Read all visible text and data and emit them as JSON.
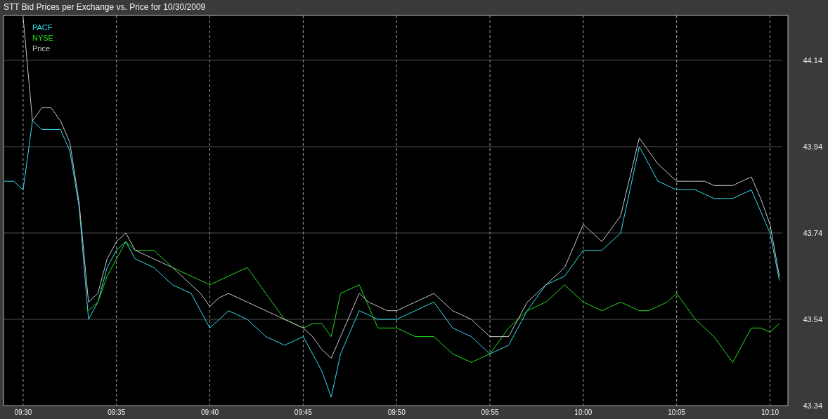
{
  "chart": {
    "chart_data": {
      "type": "line",
      "title": "STT Bid Prices per Exchange vs. Price for 10/30/2009",
      "grid": true,
      "ylim": [
        43.34,
        44.244
      ],
      "yticks": [
        {
          "value": 43.34,
          "label": "43.34"
        },
        {
          "value": 43.54,
          "label": "43.54"
        },
        {
          "value": 43.74,
          "label": "43.74"
        },
        {
          "value": 43.94,
          "label": "43.94"
        },
        {
          "value": 44.14,
          "label": "44.14"
        }
      ],
      "categories": [
        null,
        null,
        "09:30",
        null,
        null,
        null,
        null,
        null,
        null,
        null,
        null,
        null,
        "09:35",
        null,
        null,
        null,
        null,
        null,
        null,
        null,
        null,
        null,
        "09:40",
        null,
        null,
        null,
        null,
        null,
        null,
        null,
        null,
        null,
        "09:45",
        null,
        null,
        null,
        null,
        null,
        null,
        null,
        null,
        null,
        "09:50",
        null,
        null,
        null,
        null,
        null,
        null,
        null,
        null,
        null,
        "09:55",
        null,
        null,
        null,
        null,
        null,
        null,
        null,
        null,
        null,
        "10:00",
        null,
        null,
        null,
        null,
        null,
        null,
        null,
        null,
        null,
        "10:05",
        null,
        null,
        null,
        null,
        null,
        null,
        null,
        null,
        null,
        "10:10",
        null
      ],
      "series": [
        {
          "name": "PACF",
          "color": "#33e0f0",
          "values": [
            43.86,
            43.86,
            43.84,
            44.0,
            43.98,
            43.98,
            43.98,
            43.93,
            43.8,
            43.54,
            43.58,
            43.66,
            43.7,
            43.72,
            43.68,
            43.67,
            43.66,
            43.64,
            43.62,
            43.61,
            43.6,
            43.56,
            43.52,
            43.54,
            43.56,
            43.55,
            43.54,
            43.52,
            43.5,
            43.49,
            43.48,
            43.49,
            43.5,
            43.46,
            43.42,
            43.36,
            43.46,
            43.51,
            43.56,
            43.55,
            43.54,
            43.54,
            43.54,
            43.55,
            43.56,
            43.57,
            43.58,
            43.55,
            43.52,
            43.51,
            43.5,
            43.48,
            43.46,
            43.47,
            43.48,
            43.52,
            43.56,
            43.59,
            43.62,
            43.63,
            43.64,
            43.67,
            43.7,
            43.7,
            43.7,
            43.72,
            43.74,
            43.84,
            43.94,
            43.9,
            43.86,
            43.85,
            43.84,
            43.84,
            43.84,
            43.83,
            43.82,
            43.82,
            43.82,
            43.83,
            43.84,
            43.79,
            43.74,
            43.63
          ]
        },
        {
          "name": "NYSE",
          "color": "#22e01a",
          "values": [
            null,
            null,
            null,
            null,
            null,
            null,
            null,
            null,
            null,
            43.56,
            43.58,
            43.64,
            43.68,
            43.72,
            43.7,
            43.7,
            43.7,
            43.68,
            43.66,
            43.65,
            43.64,
            43.63,
            43.62,
            43.63,
            43.64,
            43.65,
            43.66,
            43.63,
            43.6,
            43.57,
            43.54,
            43.53,
            43.52,
            43.53,
            43.53,
            43.5,
            43.6,
            43.61,
            43.62,
            43.57,
            43.52,
            43.52,
            43.52,
            43.51,
            43.5,
            43.5,
            43.5,
            43.48,
            43.46,
            43.45,
            43.44,
            43.45,
            43.46,
            43.49,
            43.52,
            43.54,
            43.56,
            43.57,
            43.58,
            43.6,
            43.62,
            43.6,
            43.58,
            43.57,
            43.56,
            43.57,
            43.58,
            43.57,
            43.56,
            43.56,
            43.57,
            43.58,
            43.6,
            43.57,
            43.54,
            43.52,
            43.5,
            43.47,
            43.44,
            43.48,
            43.52,
            43.52,
            43.51,
            43.53
          ]
        },
        {
          "name": "Price",
          "color": "#c8c8c8",
          "values": [
            null,
            null,
            44.24,
            44.0,
            44.03,
            44.03,
            44.0,
            43.95,
            43.81,
            43.58,
            43.6,
            43.68,
            43.72,
            43.74,
            43.7,
            43.69,
            43.68,
            43.67,
            43.66,
            43.64,
            43.62,
            43.6,
            43.57,
            43.59,
            43.6,
            43.59,
            43.58,
            43.57,
            43.56,
            43.55,
            43.54,
            43.53,
            43.52,
            43.5,
            43.47,
            43.45,
            43.5,
            43.55,
            43.6,
            43.58,
            43.57,
            43.56,
            43.56,
            43.57,
            43.58,
            43.59,
            43.6,
            43.58,
            43.56,
            43.55,
            43.54,
            43.52,
            43.5,
            43.5,
            43.5,
            43.54,
            43.58,
            43.6,
            43.62,
            43.64,
            43.66,
            43.71,
            43.76,
            43.74,
            43.72,
            43.75,
            43.78,
            43.87,
            43.96,
            43.93,
            43.9,
            43.88,
            43.86,
            43.86,
            43.86,
            43.86,
            43.85,
            43.85,
            43.85,
            43.86,
            43.87,
            43.82,
            43.76,
            43.64
          ]
        }
      ]
    }
  }
}
